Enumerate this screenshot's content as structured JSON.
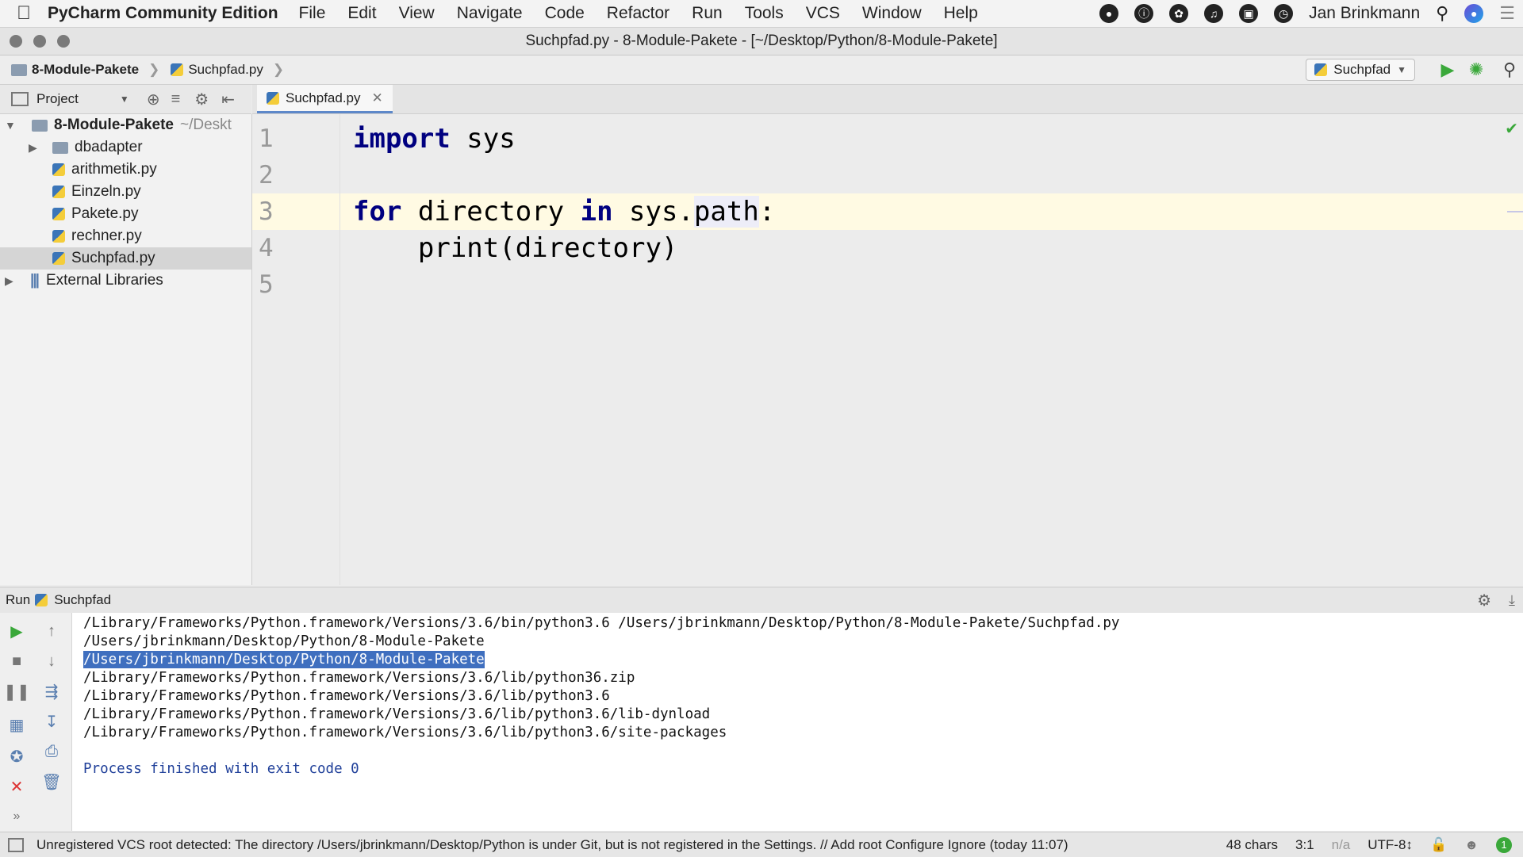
{
  "menubar": {
    "app_name": "PyCharm Community Edition",
    "items": [
      "File",
      "Edit",
      "View",
      "Navigate",
      "Code",
      "Refactor",
      "Run",
      "Tools",
      "VCS",
      "Window",
      "Help"
    ],
    "user": "Jan Brinkmann"
  },
  "window": {
    "title": "Suchpfad.py - 8-Module-Pakete - [~/Desktop/Python/8-Module-Pakete]"
  },
  "navbar": {
    "breadcrumbs": [
      "8-Module-Pakete",
      "Suchpfad.py"
    ],
    "run_config": "Suchpfad"
  },
  "project_panel": {
    "label": "Project",
    "root": {
      "name": "8-Module-Pakete",
      "path": "~/Deskt"
    },
    "items": [
      {
        "name": "dbadapter",
        "type": "folder"
      },
      {
        "name": "arithmetik.py",
        "type": "file"
      },
      {
        "name": "Einzeln.py",
        "type": "file"
      },
      {
        "name": "Pakete.py",
        "type": "file"
      },
      {
        "name": "rechner.py",
        "type": "file"
      },
      {
        "name": "Suchpfad.py",
        "type": "file",
        "selected": true
      }
    ],
    "external": "External Libraries"
  },
  "editor": {
    "tab_label": "Suchpfad.py",
    "line_numbers": [
      "1",
      "2",
      "3",
      "4",
      "5"
    ],
    "code": {
      "l1_kw": "import",
      "l1_rest": " sys",
      "l3_kw1": "for",
      "l3_a": " directory ",
      "l3_kw2": "in",
      "l3_b": " sys.",
      "l3_attr": "path",
      "l3_c": ":",
      "l4": "    print(directory)"
    }
  },
  "run_panel": {
    "label": "Run",
    "config": "Suchpfad",
    "output": [
      "/Library/Frameworks/Python.framework/Versions/3.6/bin/python3.6 /Users/jbrinkmann/Desktop/Python/8-Module-Pakete/Suchpfad.py",
      "/Users/jbrinkmann/Desktop/Python/8-Module-Pakete",
      "/Users/jbrinkmann/Desktop/Python/8-Module-Pakete",
      "/Library/Frameworks/Python.framework/Versions/3.6/lib/python36.zip",
      "/Library/Frameworks/Python.framework/Versions/3.6/lib/python3.6",
      "/Library/Frameworks/Python.framework/Versions/3.6/lib/python3.6/lib-dynload",
      "/Library/Frameworks/Python.framework/Versions/3.6/lib/python3.6/site-packages",
      "Process finished with exit code 0"
    ]
  },
  "statusbar": {
    "message": "Unregistered VCS root detected: The directory /Users/jbrinkmann/Desktop/Python is under Git, but is not registered in the Settings. // Add root  Configure  Ignore (today 11:07)",
    "chars": "48 chars",
    "position": "3:1",
    "na": "n/a",
    "encoding": "UTF-8↕",
    "event_count": "1"
  },
  "colors": {
    "keyword": "#000080",
    "selection": "#3f6fbf",
    "current_line": "#fffae3",
    "run_green": "#3aa83a",
    "stop_red": "#d33"
  },
  "icons": [
    "apple-icon",
    "run-icon",
    "debug-icon",
    "search-icon",
    "gear-icon",
    "python-file-icon",
    "folder-icon"
  ]
}
